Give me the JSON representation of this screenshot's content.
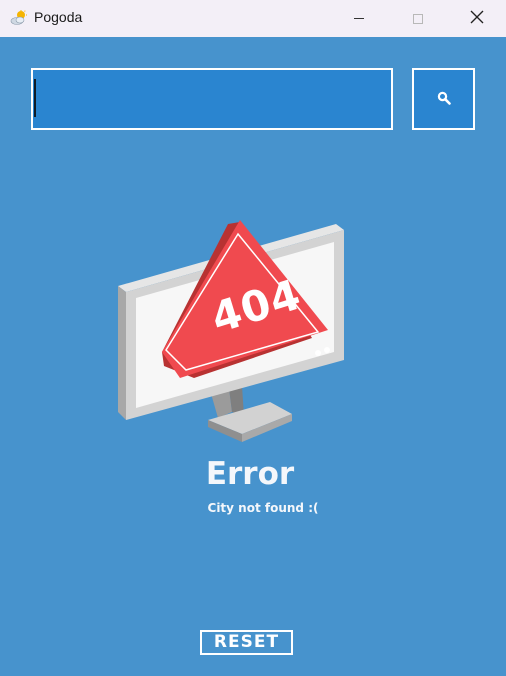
{
  "window": {
    "title": "Pogoda",
    "app_icon": "weather-sun-cloud-icon"
  },
  "search": {
    "value": "",
    "placeholder": "",
    "button_icon": "search-icon"
  },
  "illustration": {
    "badge_text": "404",
    "icon": "monitor-404-warning-icon"
  },
  "error": {
    "title": "Error",
    "message": "City not found :("
  },
  "reset": {
    "label": "RESET"
  },
  "colors": {
    "background": "#4793cd",
    "input_fill": "#2a85d0",
    "titlebar": "#f3eff7",
    "warning_red": "#f04a4f"
  }
}
